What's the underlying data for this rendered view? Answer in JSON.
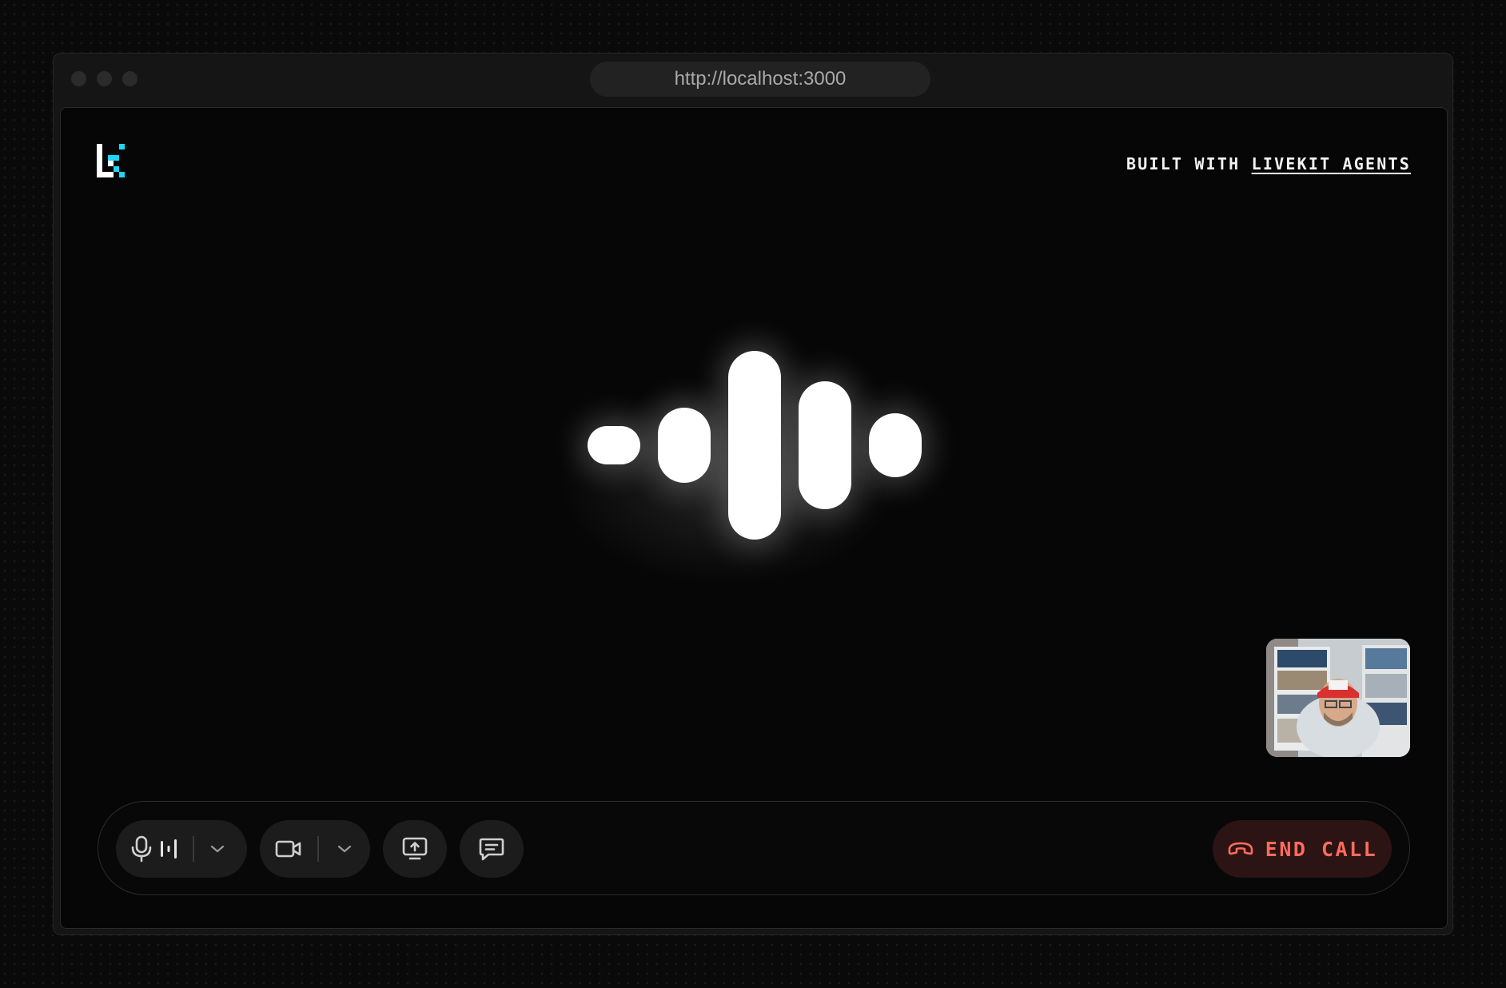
{
  "browser": {
    "url": "http://localhost:3000"
  },
  "header": {
    "built_with_prefix": "BUILT WITH ",
    "built_with_link": "LIVEKIT AGENTS"
  },
  "visualizer": {
    "levels": [
      0.2,
      0.4,
      1.0,
      0.68,
      0.34
    ]
  },
  "controls": {
    "mic_icon": "microphone-icon",
    "audio_level_icon": "audio-level-icon",
    "camera_icon": "video-camera-icon",
    "screen_share_icon": "screen-share-icon",
    "chat_icon": "chat-icon",
    "end_call_label": "END CALL",
    "end_call_icon": "phone-hangup-icon"
  },
  "colors": {
    "accent_cyan": "#1fd5f9",
    "end_call_text": "#ff6b5e",
    "end_call_bg": "#2b1413"
  }
}
